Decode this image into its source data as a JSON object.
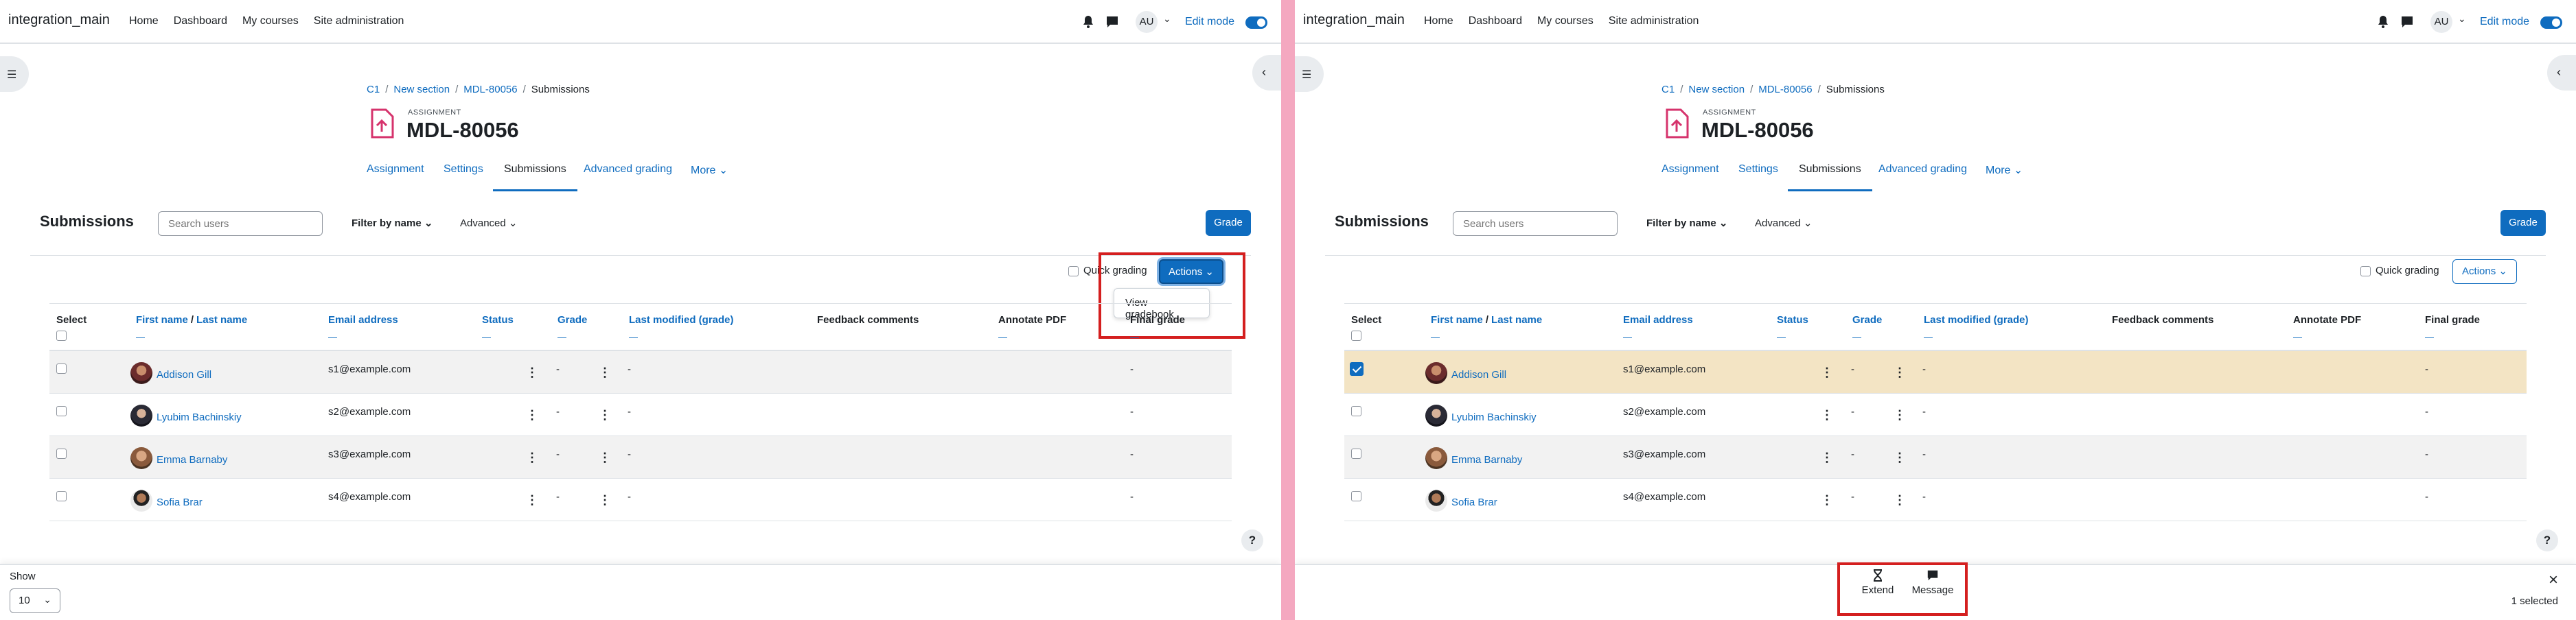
{
  "divider_color": "#f4a8c0",
  "accent_color": "#0f6cbf",
  "highlight_color": "#d41f1f",
  "selected_row_color": "#f3e4c4",
  "panels": [
    {
      "brand": "integration_main",
      "nav": [
        "Home",
        "Dashboard",
        "My courses",
        "Site administration"
      ],
      "user_initials": "AU",
      "edit_mode_label": "Edit mode",
      "breadcrumb": [
        "C1",
        "New section",
        "MDL-80056",
        "Submissions"
      ],
      "assignment_label": "ASSIGNMENT",
      "assignment_title": "MDL-80056",
      "tabs": [
        "Assignment",
        "Settings",
        "Submissions",
        "Advanced grading",
        "More"
      ],
      "active_tab": "Submissions",
      "submissions_heading": "Submissions",
      "search_placeholder": "Search users",
      "filter_label": "Filter by name",
      "advanced_label": "Advanced",
      "grade_button": "Grade",
      "quick_grading_label": "Quick grading",
      "actions_label": "Actions",
      "actions_menu_open": true,
      "actions_menu_items": [
        "View gradebook"
      ],
      "columns": {
        "select": "Select",
        "first_name": "First name",
        "slash": "/",
        "last_name": "Last name",
        "email": "Email address",
        "status": "Status",
        "grade": "Grade",
        "last_modified": "Last modified (grade)",
        "feedback": "Feedback comments",
        "annotate": "Annotate PDF",
        "final_grade": "Final grade"
      },
      "rows": [
        {
          "name": "Addison Gill",
          "email": "s1@example.com",
          "grade": "-",
          "last_modified": "-",
          "final_grade": "-",
          "selected": false
        },
        {
          "name": "Lyubim Bachinskiy",
          "email": "s2@example.com",
          "grade": "-",
          "last_modified": "-",
          "final_grade": "-",
          "selected": false
        },
        {
          "name": "Emma Barnaby",
          "email": "s3@example.com",
          "grade": "-",
          "last_modified": "-",
          "final_grade": "-",
          "selected": false
        },
        {
          "name": "Sofia Brar",
          "email": "s4@example.com",
          "grade": "-",
          "last_modified": "-",
          "final_grade": "-",
          "selected": false
        }
      ],
      "footer": {
        "show_label": "Show",
        "show_value": "10"
      },
      "help_label": "?"
    },
    {
      "brand": "integration_main",
      "nav": [
        "Home",
        "Dashboard",
        "My courses",
        "Site administration"
      ],
      "user_initials": "AU",
      "edit_mode_label": "Edit mode",
      "breadcrumb": [
        "C1",
        "New section",
        "MDL-80056",
        "Submissions"
      ],
      "assignment_label": "ASSIGNMENT",
      "assignment_title": "MDL-80056",
      "tabs": [
        "Assignment",
        "Settings",
        "Submissions",
        "Advanced grading",
        "More"
      ],
      "active_tab": "Submissions",
      "submissions_heading": "Submissions",
      "search_placeholder": "Search users",
      "filter_label": "Filter by name",
      "advanced_label": "Advanced",
      "grade_button": "Grade",
      "quick_grading_label": "Quick grading",
      "actions_label": "Actions",
      "actions_menu_open": false,
      "actions_menu_items": [],
      "columns": {
        "select": "Select",
        "first_name": "First name",
        "slash": "/",
        "last_name": "Last name",
        "email": "Email address",
        "status": "Status",
        "grade": "Grade",
        "last_modified": "Last modified (grade)",
        "feedback": "Feedback comments",
        "annotate": "Annotate PDF",
        "final_grade": "Final grade"
      },
      "rows": [
        {
          "name": "Addison Gill",
          "email": "s1@example.com",
          "grade": "-",
          "last_modified": "-",
          "final_grade": "-",
          "selected": true
        },
        {
          "name": "Lyubim Bachinskiy",
          "email": "s2@example.com",
          "grade": "-",
          "last_modified": "-",
          "final_grade": "-",
          "selected": false
        },
        {
          "name": "Emma Barnaby",
          "email": "s3@example.com",
          "grade": "-",
          "last_modified": "-",
          "final_grade": "-",
          "selected": false
        },
        {
          "name": "Sofia Brar",
          "email": "s4@example.com",
          "grade": "-",
          "last_modified": "-",
          "final_grade": "-",
          "selected": false
        }
      ],
      "footer": {
        "bulk_actions": [
          {
            "label": "Extend",
            "icon": "hourglass-icon"
          },
          {
            "label": "Message",
            "icon": "message-icon"
          }
        ],
        "close_label": "×",
        "selected_count": "1 selected"
      },
      "help_label": "?"
    }
  ]
}
